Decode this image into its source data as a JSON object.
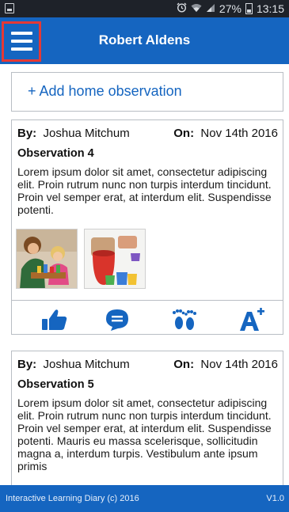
{
  "status_bar": {
    "battery_percent": "27%",
    "time": "13:15",
    "icons": [
      "screenshot-icon",
      "alarm-icon",
      "wifi-icon",
      "signal-icon",
      "battery-icon"
    ]
  },
  "app_bar": {
    "title": "Robert Aldens",
    "menu_icon": "hamburger-menu-icon",
    "color": "#1565c0",
    "menu_highlight_color": "#e53935"
  },
  "add_observation": {
    "label": "+ Add home observation"
  },
  "observations": [
    {
      "by_label": "By:",
      "author": "Joshua Mitchum",
      "on_label": "On:",
      "date": "Nov 14th 2016",
      "title": "Observation 4",
      "text": "Lorem ipsum dolor sit amet, consectetur adipiscing elit. Proin rutrum nunc non turpis interdum tincidunt. Proin vel semper erat, at interdum elit. Suspendisse potenti.",
      "photos": [
        "child-with-adult-photo",
        "stacking-cups-photo"
      ],
      "actions": [
        "thumbs-up-icon",
        "comment-icon",
        "footprints-icon",
        "a-plus-icon"
      ]
    },
    {
      "by_label": "By:",
      "author": "Joshua Mitchum",
      "on_label": "On:",
      "date": "Nov 14th 2016",
      "title": "Observation 5",
      "text": "Lorem ipsum dolor sit amet, consectetur adipiscing elit. Proin rutrum nunc non turpis interdum tincidunt. Proin vel semper erat, at interdum elit. Suspendisse potenti. Mauris eu massa scelerisque, sollicitudin magna a, interdum turpis. Vestibulum ante ipsum primis"
    }
  ],
  "footer": {
    "left": "Interactive Learning Diary (c) 2016",
    "right": "V1.0"
  }
}
